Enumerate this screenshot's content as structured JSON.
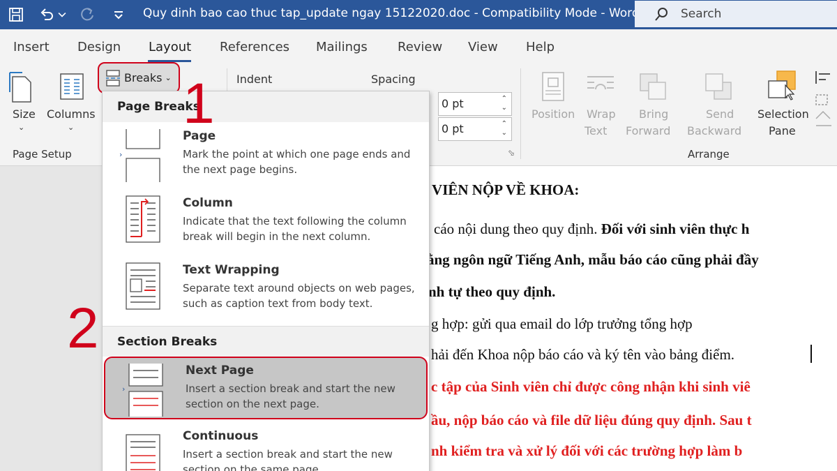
{
  "titlebar": {
    "title": "Quy dinh bao cao thuc tap_update ngay 15122020.doc  -  Compatibility Mode  -  Word",
    "search_label": "Search"
  },
  "tabs": [
    "Insert",
    "Design",
    "Layout",
    "References",
    "Mailings",
    "Review",
    "View",
    "Help"
  ],
  "active_tab": "Layout",
  "ribbon": {
    "size_label": "Size",
    "columns_label": "Columns",
    "breaks_label": "Breaks",
    "page_setup_label": "Page Setup",
    "indent_label": "Indent",
    "spacing_label": "Spacing",
    "spacing_before": "0 pt",
    "spacing_after": "0 pt",
    "position_label": "Position",
    "wrap_label": [
      "Wrap",
      "Text"
    ],
    "bring_label": [
      "Bring",
      "Forward"
    ],
    "send_label": [
      "Send",
      "Backward"
    ],
    "selection_label": [
      "Selection",
      "Pane"
    ],
    "arrange_label": "Arrange"
  },
  "menu": {
    "page_breaks_header": "Page Breaks",
    "section_breaks_header": "Section Breaks",
    "items": [
      {
        "title": "Page",
        "desc": "Mark the point at which one page ends and the next page begins."
      },
      {
        "title": "Column",
        "desc": "Indicate that the text following the column break will begin in the next column."
      },
      {
        "title": "Text Wrapping",
        "desc": "Separate text around objects on web pages, such as caption text from body text."
      },
      {
        "title": "Next Page",
        "desc": "Insert a section break and start the new section on the next page."
      },
      {
        "title": "Continuous",
        "desc": "Insert a section break and start the new section on the same page."
      }
    ]
  },
  "annotations": {
    "step1": "1",
    "step2": "2"
  },
  "document": {
    "line1": "I VIÊN NỘP VỀ KHOA:",
    "line2a": "cáo nội dung theo quy định. ",
    "line2b": "Đối với sinh viên thực h",
    "line3": "ằng ngôn ngữ Tiếng Anh, mẫu báo cáo cũng phải đầy",
    "line4": "nh tự theo quy định.",
    "line5": "g hợp: gửi qua email do lớp trưởng tổng hợp",
    "line6": "hải đến Khoa nộp báo cáo và ký tên vào bảng điểm.",
    "line7": "c tập của Sinh viên chỉ được công nhận khi sinh viê",
    "line8": "ầu, nộp báo cáo và file dữ liệu đúng quy định. Sau t",
    "line9": "nh kiểm tra và xử lý đối với các trường hợp làm b"
  },
  "colors": {
    "titlebar": "#2b579a",
    "highlight": "#d0021b",
    "red_text": "#e02020"
  }
}
